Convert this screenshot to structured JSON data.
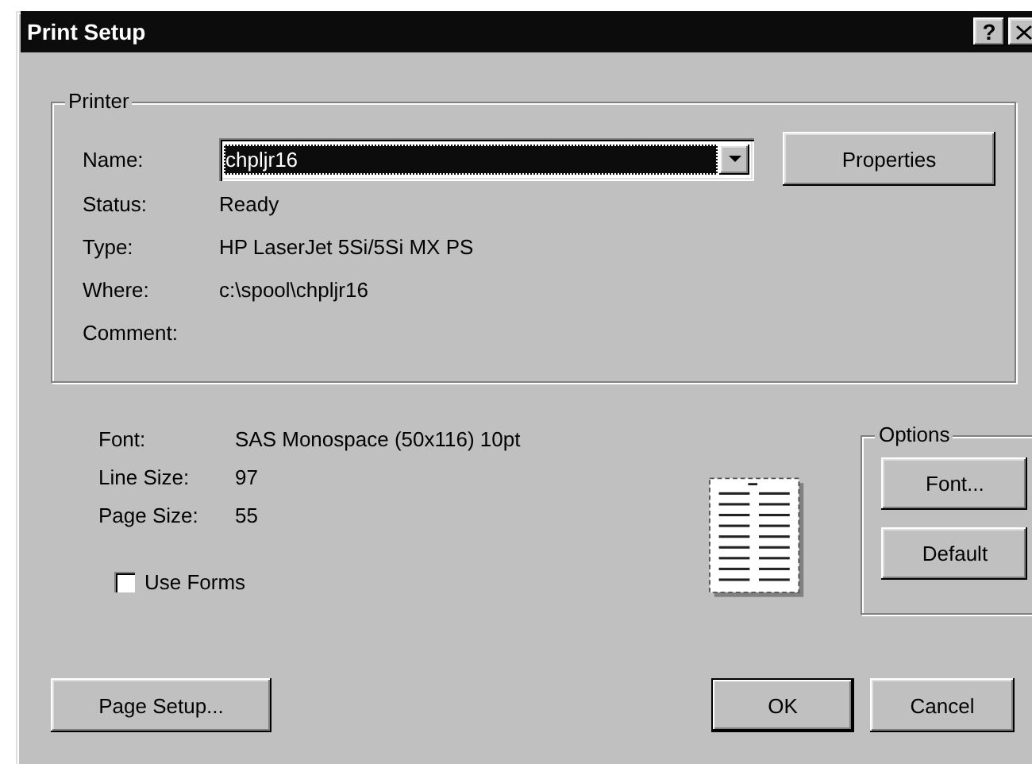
{
  "window": {
    "title": "Print Setup",
    "help_button": "?"
  },
  "printer": {
    "legend": "Printer",
    "name_label": "Name:",
    "name_value": "chpljr16",
    "properties_button": "Properties",
    "details": [
      {
        "label": "Status:",
        "value": "Ready"
      },
      {
        "label": "Type:",
        "value": "HP LaserJet 5Si/5Si MX PS"
      },
      {
        "label": "Where:",
        "value": "c:\\spool\\chpljr16"
      },
      {
        "label": "Comment:"
      }
    ]
  },
  "settings": [
    {
      "label": "Font:",
      "value": "SAS Monospace (50x116) 10pt"
    },
    {
      "label": "Line Size:",
      "value": "97"
    },
    {
      "label": "Page Size:",
      "value": "55"
    }
  ],
  "use_forms": {
    "label": "Use Forms",
    "checked": false
  },
  "options": {
    "legend": "Options",
    "buttons": [
      "Font...",
      "Default"
    ]
  },
  "buttons": [
    {
      "label": "Page Setup...",
      "default": false
    },
    {
      "label": "OK",
      "default": true
    },
    {
      "label": "Cancel",
      "default": false
    }
  ]
}
